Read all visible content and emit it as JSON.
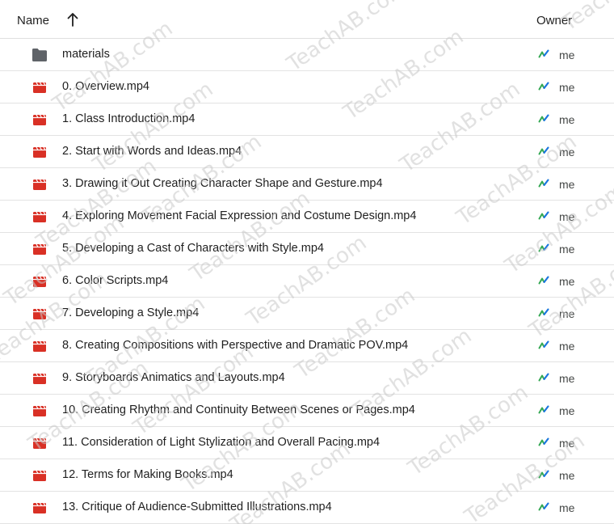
{
  "header": {
    "name_label": "Name",
    "owner_label": "Owner",
    "sort_icon": "arrow-up-icon"
  },
  "files": [
    {
      "name": "materials",
      "type": "folder",
      "icon": "folder-icon",
      "owner": "me"
    },
    {
      "name": "0. Overview.mp4",
      "type": "video",
      "icon": "video-file-icon",
      "owner": "me"
    },
    {
      "name": "1. Class Introduction.mp4",
      "type": "video",
      "icon": "video-file-icon",
      "owner": "me"
    },
    {
      "name": "2. Start with Words and Ideas.mp4",
      "type": "video",
      "icon": "video-file-icon",
      "owner": "me"
    },
    {
      "name": "3. Drawing it Out Creating Character Shape and Gesture.mp4",
      "type": "video",
      "icon": "video-file-icon",
      "owner": "me"
    },
    {
      "name": "4. Exploring Movement Facial Expression and Costume Design.mp4",
      "type": "video",
      "icon": "video-file-icon",
      "owner": "me"
    },
    {
      "name": "5. Developing a Cast of Characters with Style.mp4",
      "type": "video",
      "icon": "video-file-icon",
      "owner": "me"
    },
    {
      "name": "6. Color Scripts.mp4",
      "type": "video",
      "icon": "video-file-icon",
      "owner": "me"
    },
    {
      "name": "7. Developing a Style.mp4",
      "type": "video",
      "icon": "video-file-icon",
      "owner": "me"
    },
    {
      "name": "8. Creating Compositions with Perspective and Dramatic POV.mp4",
      "type": "video",
      "icon": "video-file-icon",
      "owner": "me"
    },
    {
      "name": "9. Storyboards Animatics and Layouts.mp4",
      "type": "video",
      "icon": "video-file-icon",
      "owner": "me"
    },
    {
      "name": "10. Creating Rhythm and Continuity Between Scenes or Pages.mp4",
      "type": "video",
      "icon": "video-file-icon",
      "owner": "me"
    },
    {
      "name": "11. Consideration of Light Stylization and Overall Pacing.mp4",
      "type": "video",
      "icon": "video-file-icon",
      "owner": "me"
    },
    {
      "name": "12. Terms for Making Books.mp4",
      "type": "video",
      "icon": "video-file-icon",
      "owner": "me"
    },
    {
      "name": "13. Critique of Audience-Submitted Illustrations.mp4",
      "type": "video",
      "icon": "video-file-icon",
      "owner": "me"
    }
  ],
  "watermark_text": "TeachAB.com",
  "colors": {
    "folder": "#5f6368",
    "video": "#d93025",
    "owner_icon_green": "#34a853",
    "owner_icon_blue": "#1a73e8",
    "text": "#1f1f1f",
    "divider": "#e3e3e3"
  }
}
